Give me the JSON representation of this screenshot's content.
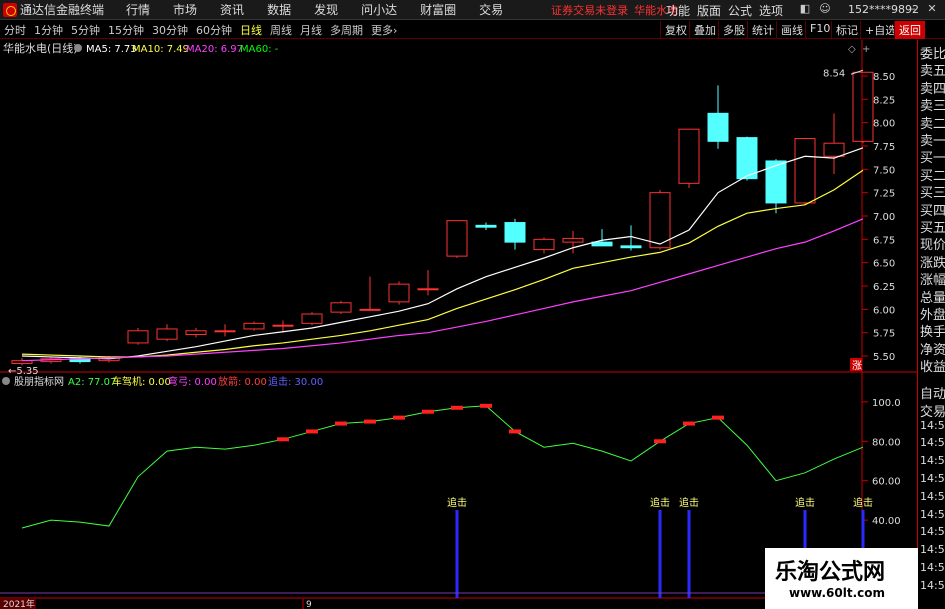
{
  "app": {
    "title": "通达信金融终端",
    "menus": [
      "行情",
      "市场",
      "资讯",
      "数据",
      "发现",
      "问小达",
      "财富圈",
      "交易"
    ],
    "account_status": "证券交易未登录",
    "account_stock": "华能水电",
    "right_menus": [
      "功能",
      "版面",
      "公式",
      "选项"
    ],
    "user_id": "152****9892"
  },
  "toolbar": {
    "periods": [
      "分时",
      "1分钟",
      "5分钟",
      "15分钟",
      "30分钟",
      "60分钟",
      "日线",
      "周线",
      "月线",
      "多周期",
      "更多"
    ],
    "active_period": "日线",
    "more_arrow": "›",
    "right_buttons": [
      "复权",
      "叠加",
      "多股",
      "统计",
      "画线",
      "F10",
      "标记",
      "+自选",
      "返回"
    ]
  },
  "main_chart": {
    "stock_title": "华能水电(日线)",
    "legend": [
      {
        "label": "MA5: 7.73",
        "color": "#ffffff"
      },
      {
        "label": "MA10: 7.49",
        "color": "#ffff40"
      },
      {
        "label": "MA20: 6.97",
        "color": "#ff40ff"
      },
      {
        "label": "MA60: -",
        "color": "#00ff00"
      }
    ],
    "top_price": "8.54",
    "low_price": "5.35",
    "up_badge": "涨",
    "price_ticks": [
      "8.50",
      "8.25",
      "8.00",
      "7.75",
      "7.50",
      "7.25",
      "7.00",
      "6.75",
      "6.50",
      "6.25",
      "6.00",
      "5.75",
      "5.50"
    ],
    "candles": [
      {
        "o": 5.42,
        "c": 5.45,
        "h": 5.48,
        "l": 5.4
      },
      {
        "o": 5.44,
        "c": 5.47,
        "h": 5.49,
        "l": 5.42
      },
      {
        "o": 5.47,
        "c": 5.44,
        "h": 5.49,
        "l": 5.42
      },
      {
        "o": 5.45,
        "c": 5.48,
        "h": 5.5,
        "l": 5.43
      },
      {
        "o": 5.64,
        "c": 5.77,
        "h": 5.8,
        "l": 5.62
      },
      {
        "o": 5.68,
        "c": 5.79,
        "h": 5.84,
        "l": 5.66
      },
      {
        "o": 5.73,
        "c": 5.77,
        "h": 5.8,
        "l": 5.7
      },
      {
        "o": 5.76,
        "c": 5.77,
        "h": 5.84,
        "l": 5.71
      },
      {
        "o": 5.79,
        "c": 5.85,
        "h": 5.87,
        "l": 5.77
      },
      {
        "o": 5.82,
        "c": 5.83,
        "h": 5.88,
        "l": 5.75
      },
      {
        "o": 5.85,
        "c": 5.95,
        "h": 5.97,
        "l": 5.83
      },
      {
        "o": 5.97,
        "c": 6.07,
        "h": 6.09,
        "l": 5.95
      },
      {
        "o": 6.0,
        "c": 6.0,
        "h": 6.35,
        "l": 5.98
      },
      {
        "o": 6.08,
        "c": 6.27,
        "h": 6.3,
        "l": 6.05
      },
      {
        "o": 6.22,
        "c": 6.22,
        "h": 6.42,
        "l": 6.15
      },
      {
        "o": 6.57,
        "c": 6.95,
        "h": 6.95,
        "l": 6.55
      },
      {
        "o": 6.9,
        "c": 6.88,
        "h": 6.93,
        "l": 6.85
      },
      {
        "o": 6.93,
        "c": 6.72,
        "h": 6.97,
        "l": 6.64
      },
      {
        "o": 6.64,
        "c": 6.75,
        "h": 6.77,
        "l": 6.6
      },
      {
        "o": 6.72,
        "c": 6.76,
        "h": 6.84,
        "l": 6.6
      },
      {
        "o": 6.72,
        "c": 6.68,
        "h": 6.86,
        "l": 6.68
      },
      {
        "o": 6.68,
        "c": 6.66,
        "h": 6.9,
        "l": 6.63
      },
      {
        "o": 6.66,
        "c": 7.25,
        "h": 7.28,
        "l": 6.64
      },
      {
        "o": 7.35,
        "c": 7.93,
        "h": 7.93,
        "l": 7.3
      },
      {
        "o": 8.1,
        "c": 7.8,
        "h": 8.4,
        "l": 7.72
      },
      {
        "o": 7.84,
        "c": 7.4,
        "h": 7.85,
        "l": 7.38
      },
      {
        "o": 7.59,
        "c": 7.14,
        "h": 7.61,
        "l": 7.03
      },
      {
        "o": 7.14,
        "c": 7.83,
        "h": 7.83,
        "l": 7.12
      },
      {
        "o": 7.64,
        "c": 7.78,
        "h": 8.1,
        "l": 7.45
      },
      {
        "o": 7.8,
        "c": 8.54,
        "h": 8.54,
        "l": 7.78
      }
    ],
    "ma5": [
      5.5,
      5.49,
      5.48,
      5.47,
      5.5,
      5.55,
      5.6,
      5.66,
      5.72,
      5.76,
      5.8,
      5.86,
      5.92,
      5.98,
      6.06,
      6.22,
      6.35,
      6.45,
      6.55,
      6.66,
      6.74,
      6.78,
      6.7,
      6.85,
      7.25,
      7.43,
      7.54,
      7.64,
      7.62,
      7.73
    ],
    "ma10": [
      5.52,
      5.51,
      5.5,
      5.49,
      5.49,
      5.51,
      5.54,
      5.57,
      5.61,
      5.64,
      5.68,
      5.72,
      5.77,
      5.83,
      5.89,
      6.01,
      6.11,
      6.21,
      6.32,
      6.44,
      6.5,
      6.56,
      6.61,
      6.71,
      6.89,
      7.03,
      7.08,
      7.12,
      7.28,
      7.49
    ],
    "ma20": [
      5.45,
      5.46,
      5.47,
      5.48,
      5.49,
      5.5,
      5.52,
      5.54,
      5.56,
      5.58,
      5.61,
      5.64,
      5.68,
      5.72,
      5.75,
      5.81,
      5.87,
      5.94,
      6.01,
      6.08,
      6.14,
      6.2,
      6.29,
      6.38,
      6.47,
      6.56,
      6.65,
      6.72,
      6.84,
      6.97
    ],
    "y_min": 5.35,
    "y_max": 8.65
  },
  "indicator": {
    "name": "股朋指标网",
    "legend": [
      {
        "label": "A2: 77.07",
        "color": "#40ff40"
      },
      {
        "label": "车驾机: 0.00",
        "color": "#ffff40"
      },
      {
        "label": "弯弓: 0.00",
        "color": "#ff40ff"
      },
      {
        "label": "放箭: 0.00",
        "color": "#ff4040"
      },
      {
        "label": "追击: 30.00",
        "color": "#4040ff"
      }
    ],
    "ticks": [
      "100.0",
      "80.00",
      "60.00",
      "40.00"
    ],
    "a2": [
      36,
      40,
      39,
      37,
      62,
      75,
      77,
      76,
      78,
      81,
      85,
      89,
      90,
      92,
      95,
      97,
      98,
      85,
      77,
      79,
      75,
      70,
      80,
      89,
      92,
      78,
      60,
      64,
      71,
      77
    ],
    "red_marks": [
      9,
      10,
      11,
      12,
      13,
      14,
      15,
      16,
      17,
      22,
      23,
      24
    ],
    "chase_label": "追击",
    "chase_bars": [
      15,
      22,
      23,
      27,
      29
    ],
    "y_min": 35,
    "y_max": 105
  },
  "right_panel": {
    "labels": [
      "委比",
      "卖五",
      "卖四",
      "卖三",
      "卖二",
      "卖一",
      "买一",
      "买二",
      "买三",
      "买四",
      "买五",
      "现价",
      "涨跌",
      "涨幅",
      "总量",
      "外盘",
      "换手",
      "净资",
      "收益"
    ],
    "lower_labels": [
      "自动",
      "交易",
      "14:56",
      "14:56",
      "14:56",
      "14:56",
      "14:56",
      "14:56",
      "14:56",
      "14:56",
      "14:56",
      "14:56"
    ]
  },
  "date_axis": {
    "year": "2021年",
    "month": "9"
  },
  "watermark": {
    "text": "乐淘公式网",
    "url": "www.60lt.com"
  },
  "chart_data": {
    "type": "candlestick",
    "title": "华能水电(日线)",
    "series": [
      {
        "name": "MA5"
      },
      {
        "name": "MA10"
      },
      {
        "name": "MA20"
      },
      {
        "name": "A2"
      }
    ]
  }
}
